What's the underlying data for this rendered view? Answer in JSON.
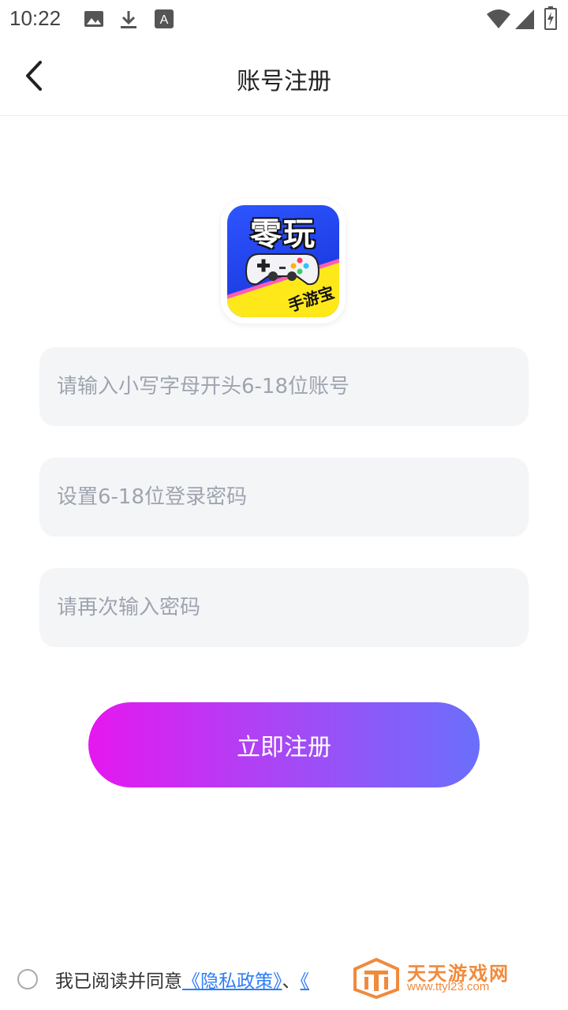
{
  "status_bar": {
    "time": "10:22",
    "icons": [
      "image-icon",
      "download-icon",
      "font-a-icon",
      "wifi-icon",
      "signal-icon",
      "battery-icon"
    ]
  },
  "app_bar": {
    "back_icon": "chevron-left-icon",
    "title": "账号注册"
  },
  "logo": {
    "title": "零玩",
    "subtitle": "手游宝"
  },
  "form": {
    "account_placeholder": "请输入小写字母开头6-18位账号",
    "password_placeholder": "设置6-18位登录密码",
    "confirm_placeholder": "请再次输入密码",
    "account_value": "",
    "password_value": "",
    "confirm_value": ""
  },
  "register_button": "立即注册",
  "agreement": {
    "prefix": "我已阅读并同意",
    "privacy_link": "《隐私政策》",
    "separator": "、",
    "next_link": "《"
  },
  "watermark": {
    "title": "天天游戏网",
    "url": "www.ttyl23.com"
  },
  "colors": {
    "accent_start": "#e617f0",
    "accent_end": "#6a6ffb",
    "link": "#2f7df6",
    "input_bg": "#f4f5f7",
    "watermark": "#f08a3c"
  }
}
